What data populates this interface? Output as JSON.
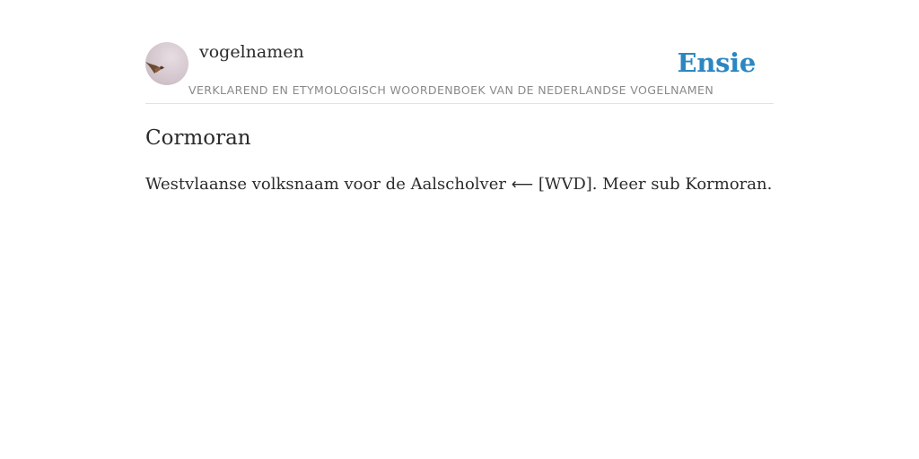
{
  "header": {
    "avatar_icon": "bird-photo-avatar",
    "site_name": "vogelnamen",
    "subtitle": "VERKLAREND EN ETYMOLOGISCH WOORDENBOEK VAN DE NEDERLANDSE VOGELNAMEN",
    "brand": "Ensie",
    "brand_color": "#2b87c1"
  },
  "entry": {
    "title": "Cormoran",
    "body_before": "Westvlaanse volksnaam voor de Aalscholver ",
    "arrow": "⟵",
    "body_after": " [WVD]. Meer sub Kormoran."
  }
}
